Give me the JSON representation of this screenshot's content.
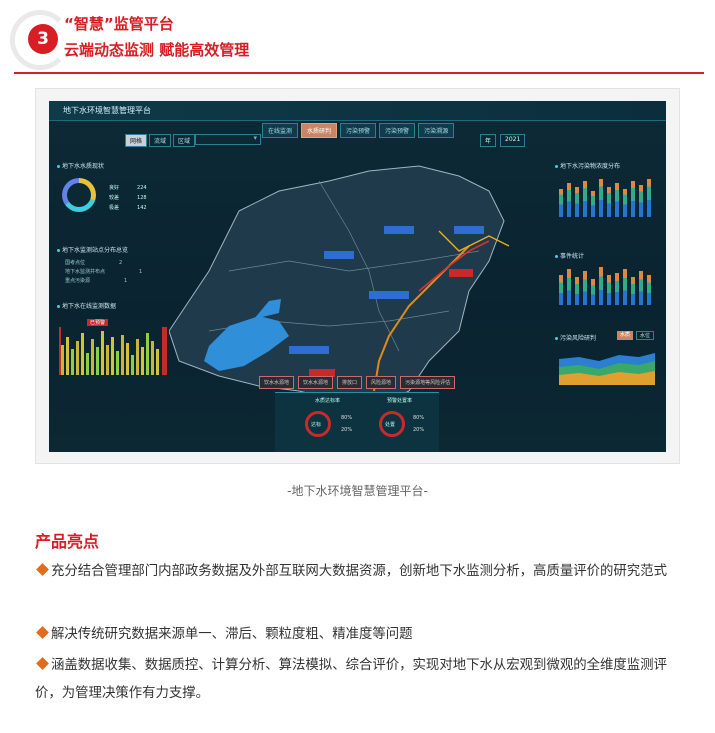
{
  "header": {
    "number": "3",
    "title": "“智慧”监管平台",
    "subtitle": "云端动态监测 赋能高效管理"
  },
  "dashboard": {
    "title": "地下水环境智慧管理平台",
    "nav_tabs": [
      "在线监测",
      "水质研判",
      "污染预警",
      "污染预警",
      "污染溯源"
    ],
    "active_tab": 1,
    "sub_tabs": [
      "网格",
      "流域",
      "区域"
    ],
    "active_sub_tab": 0,
    "year_label": "年",
    "year_value": "2021",
    "panels": {
      "status": "地下水水质现状",
      "points": "地下水监测站点分布总览",
      "trend": "地下水在线监测数据",
      "pollution": "地下水污染物浓度分布",
      "events": "事件统计",
      "risk": "污染风险研判"
    },
    "status_rows": [
      {
        "label": "良好",
        "value": "224"
      },
      {
        "label": "较差",
        "value": "128"
      },
      {
        "label": "极差",
        "value": "142"
      }
    ],
    "point_rows": [
      {
        "label": "国考点位",
        "value": "2"
      },
      {
        "label": "地下水监测井布点",
        "value": "1"
      },
      {
        "label": "重点污染源",
        "value": "1"
      }
    ],
    "alert_badge": "已预警",
    "map_buttons": [
      "饮水水源地",
      "饮水水源地",
      "排放口",
      "风险源地",
      "污染源地等风险评估"
    ],
    "gauges": [
      {
        "title": "水质达标率",
        "center": "达标",
        "pct_a": "80%",
        "pct_b": "20%"
      },
      {
        "title": "预警处置率",
        "center": "处置",
        "pct_a": "80%",
        "pct_b": "20%"
      }
    ],
    "risk_buttons": [
      "水质",
      "水位"
    ]
  },
  "caption": "-地下水环境智慧管理平台-",
  "highlights": {
    "title": "产品亮点",
    "bullets": [
      "充分结合管理部门内部政务数据及外部互联网大数据资源，创新地下水监测分析，高质量评价的研究范式",
      "解决传统研究数据来源单一、滞后、颗粒度粗、精准度等问题",
      "涵盖数据收集、数据质控、计算分析、算法模拟、综合评价，实现对地下水从宏观到微观的全维度监测评价，为管理决策作有力支撑。"
    ]
  },
  "colors": {
    "brand_red": "#d81e24",
    "bullet_orange": "#e36b1c",
    "dash_bg": "#0b2833"
  }
}
